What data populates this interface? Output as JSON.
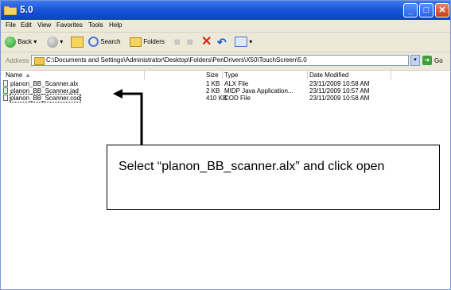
{
  "window": {
    "title": "5.0"
  },
  "menu": {
    "items": [
      "File",
      "Edit",
      "View",
      "Favorites",
      "Tools",
      "Help"
    ]
  },
  "toolbar": {
    "back_label": "Back",
    "search_label": "Search",
    "folders_label": "Folders"
  },
  "address": {
    "label": "Address",
    "value": "C:\\Documents and Settings\\Administrator\\Desktop\\Folders\\PenDrivers\\X50\\TouchScreen\\5.0",
    "go_label": "Go"
  },
  "columns": {
    "name": "Name",
    "size": "Size",
    "type": "Type",
    "date": "Date Modified"
  },
  "files": [
    {
      "name": "planon_BB_Scanner.alx",
      "size": "1 KB",
      "type": "ALX File",
      "date": "23/11/2009 10:58 AM"
    },
    {
      "name": "planon_BB_Scanner.jad",
      "size": "2 KB",
      "type": "MIDP Java Application...",
      "date": "23/11/2009 10:57 AM"
    },
    {
      "name": "planon_BB_Scanner.cod",
      "size": "410 KB",
      "type": "COD File",
      "date": "23/11/2009 10:58 AM"
    }
  ],
  "callout": {
    "text": "Select “planon_BB_scanner.alx” and click open"
  }
}
